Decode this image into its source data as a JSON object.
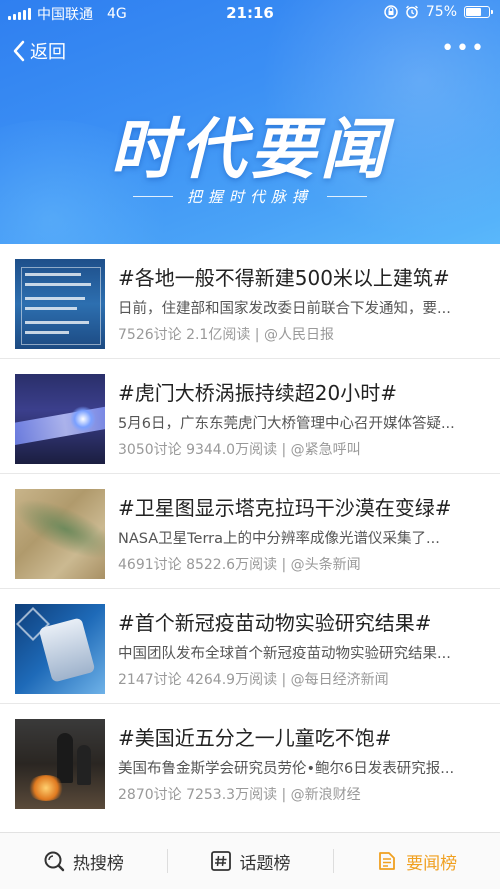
{
  "status_bar": {
    "carrier": "中国联通",
    "network": "4G",
    "time": "21:16",
    "battery": "75%",
    "battery_level": 0.75
  },
  "nav": {
    "back_label": "返回",
    "more_label": "•••"
  },
  "banner": {
    "title": "时代要闻",
    "subtitle": "把握时代脉搏"
  },
  "items": [
    {
      "title": "#各地一般不得新建500米以上建筑#",
      "desc": "日前，住建部和国家发改委日前联合下发通知，要...",
      "meta": "7526讨论 2.1亿阅读 | @人民日报"
    },
    {
      "title": "#虎门大桥涡振持续超20小时#",
      "desc": "5月6日，广东东莞虎门大桥管理中心召开媒体答疑...",
      "meta": "3050讨论 9344.0万阅读 | @紧急呼叫"
    },
    {
      "title": "#卫星图显示塔克拉玛干沙漠在变绿#",
      "desc": "NASA卫星Terra上的中分辨率成像光谱仪采集了...",
      "meta": "4691讨论 8522.6万阅读 | @头条新闻"
    },
    {
      "title": "#首个新冠疫苗动物实验研究结果#",
      "desc": "中国团队发布全球首个新冠疫苗动物实验研究结果...",
      "meta": "2147讨论 4264.9万阅读 | @每日经济新闻"
    },
    {
      "title": "#美国近五分之一儿童吃不饱#",
      "desc": "美国布鲁金斯学会研究员劳伦•鲍尔6日发表研究报...",
      "meta": "2870讨论 7253.3万阅读 | @新浪财经"
    }
  ],
  "tabs": [
    {
      "label": "热搜榜",
      "icon": "search-icon"
    },
    {
      "label": "话题榜",
      "icon": "hashtag-icon"
    },
    {
      "label": "要闻榜",
      "icon": "news-icon"
    }
  ],
  "colors": {
    "banner_blue": "#3b8ff4",
    "active_tab": "#f0a020"
  }
}
